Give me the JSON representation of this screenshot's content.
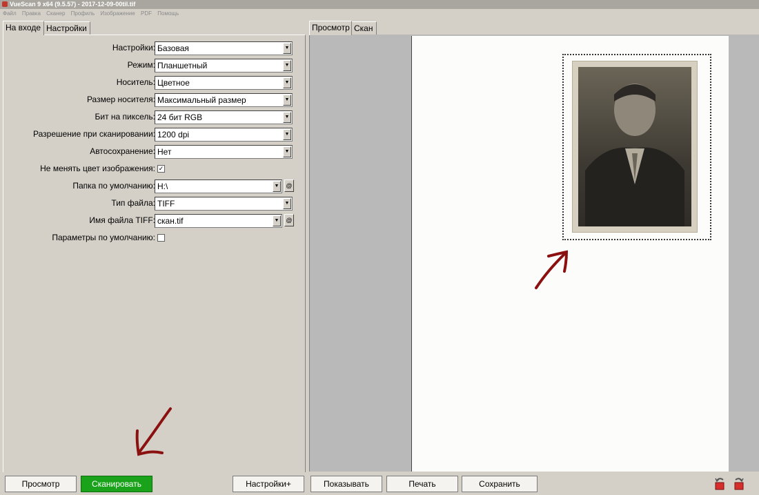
{
  "window": {
    "title": "VueScan 9 x64 (9.5.57) - 2017-12-09-00til.tif"
  },
  "menu": [
    "Файл",
    "Правка",
    "Сканер",
    "Профиль",
    "Изображение",
    "PDF",
    "Помощь"
  ],
  "left_tabs": [
    "На входе",
    "Настройки"
  ],
  "right_tabs": [
    "Просмотр",
    "Скан"
  ],
  "form": {
    "settings": {
      "label": "Настройки:",
      "value": "Базовая"
    },
    "mode": {
      "label": "Режим:",
      "value": "Планшетный"
    },
    "media": {
      "label": "Носитель:",
      "value": "Цветное"
    },
    "media_size": {
      "label": "Размер носителя:",
      "value": "Максимальный размер"
    },
    "bits": {
      "label": "Бит на пиксель:",
      "value": "24 бит RGB"
    },
    "resolution": {
      "label": "Разрешение при сканировании:",
      "value": "1200 dpi"
    },
    "autosave": {
      "label": "Автосохранение:",
      "value": "Нет"
    },
    "keep_color": {
      "label": "Не менять цвет изображения:",
      "checked": true
    },
    "folder": {
      "label": "Папка по умолчанию:",
      "value": "H:\\"
    },
    "file_type": {
      "label": "Тип файла:",
      "value": "TIFF"
    },
    "tiff_name": {
      "label": "Имя файла TIFF:",
      "value": "скан.tif"
    },
    "defaults": {
      "label": "Параметры по умолчанию:",
      "checked": false
    }
  },
  "buttons": {
    "preview": "Просмотр",
    "scan": "Сканировать",
    "settings_plus": "Настройки+",
    "show": "Показывать",
    "print": "Печать",
    "save": "Сохранить"
  },
  "colors": {
    "scan_button": "#1aa31a",
    "annotation_arrow": "#8b1010"
  }
}
